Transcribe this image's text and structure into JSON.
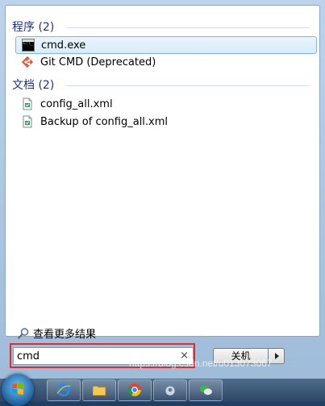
{
  "groups": [
    {
      "header": "程序 (2)",
      "items": [
        {
          "label": "cmd.exe",
          "icon": "cmd-icon",
          "selected": true
        },
        {
          "label": "Git CMD (Deprecated)",
          "icon": "git-icon",
          "selected": false
        }
      ]
    },
    {
      "header": "文档 (2)",
      "items": [
        {
          "label": "config_all.xml",
          "icon": "xml-file-icon",
          "selected": false
        },
        {
          "label": "Backup of config_all.xml",
          "icon": "xml-file-icon",
          "selected": false
        }
      ]
    }
  ],
  "see_more": {
    "label": "查看更多结果",
    "icon": "search-icon"
  },
  "search": {
    "value": "cmd",
    "clear_symbol": "×"
  },
  "shutdown": {
    "label": "关机"
  },
  "watermark": "https://blog.csdn.net/u013073067",
  "colors": {
    "highlight": "#e22c2c",
    "group_header": "#1e3287",
    "selection_border": "#7eb4ea"
  }
}
